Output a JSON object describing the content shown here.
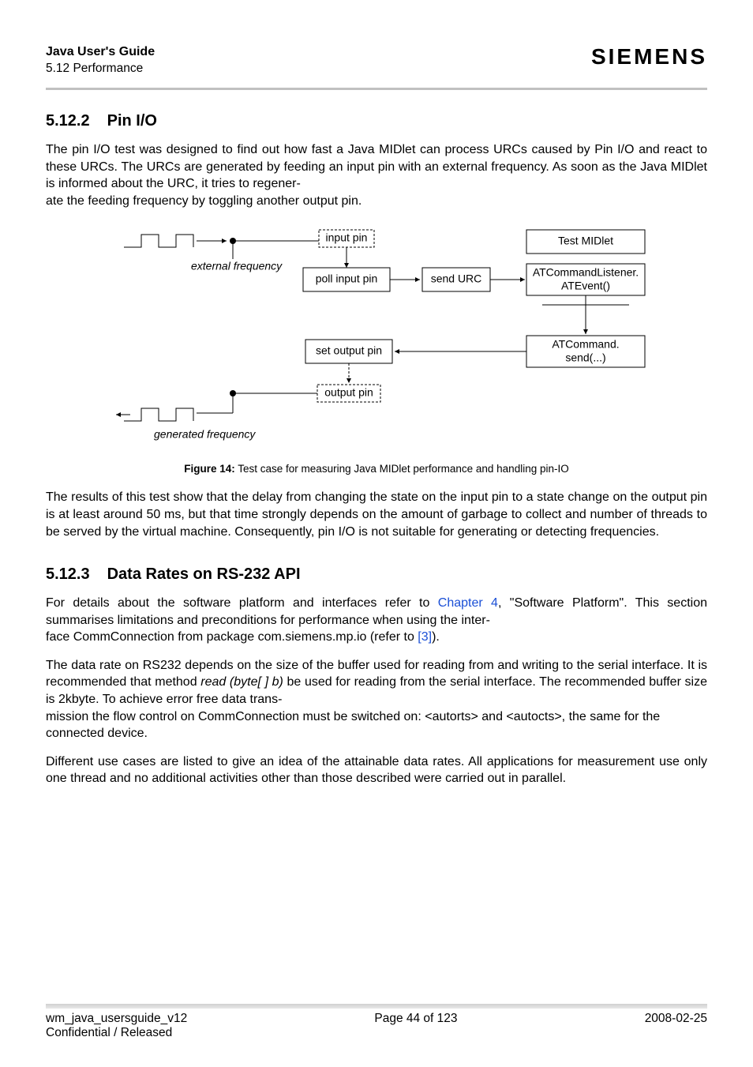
{
  "header": {
    "doc_title": "Java User's Guide",
    "doc_subtitle": "5.12 Performance",
    "brand": "SIEMENS"
  },
  "section1": {
    "number": "5.12.2",
    "title": "Pin I/O",
    "para1a": "The pin I/O test was designed to find out how fast a Java MIDlet can process URCs caused by Pin I/O and react to these URCs.  The URCs are generated by feeding an input pin with an external frequency. As soon as the Java MIDlet is informed about the URC, it tries to regener-",
    "para1b": "ate the feeding frequency by toggling another output pin."
  },
  "figure": {
    "labels": {
      "input_pin": "input pin",
      "external_frequency": "external frequency",
      "poll_input_pin": "poll input pin",
      "send_urc": "send URC",
      "test_midlet": "Test MIDlet",
      "at_listener_top": "ATCommandListener.",
      "at_listener_bot": "ATEvent()",
      "at_command_top": "ATCommand.",
      "at_command_bot": "send(...)",
      "set_output_pin": "set output pin",
      "output_pin": "output pin",
      "generated_frequency": "generated frequency"
    },
    "caption_bold": "Figure 14:",
    "caption_rest": "  Test case for measuring Java MIDlet performance and handling pin-IO"
  },
  "para2": "The results of this test show that the delay from changing the state on the input pin to a state change on the output pin is at least around 50 ms, but that time strongly depends on the amount of garbage to collect and number of threads to be served by the virtual machine. Consequently, pin I/O is not suitable for generating or detecting frequencies.",
  "section2": {
    "number": "5.12.3",
    "title": "Data Rates on RS-232 API",
    "para1_pre": "For details about the software platform and interfaces refer to ",
    "para1_link1": "Chapter 4",
    "para1_mid": ", \"Software Platform\". This section summarises limitations and preconditions for performance when using the inter-",
    "para1_row2": "face CommConnection from package com.siemens.mp.io (refer to ",
    "para1_link2": "[3]",
    "para1_post": ").",
    "para2_a": "The data rate on RS232 depends on the size of the buffer used for reading from and writing to the serial interface. It is recommended that method ",
    "para2_em": "read (byte[ ] b)",
    "para2_b": "  be used for reading from the serial interface. The recommended buffer size is 2kbyte. To achieve error free data trans-",
    "para2_c": "mission the flow control on CommConnection must be switched on: <autorts> and <autocts>, the same for the connected device.",
    "para3": "Different use cases are listed to give an idea of the attainable data rates. All applications for measurement use only one thread and no additional activities other than those described were carried out in parallel."
  },
  "footer": {
    "left1": "wm_java_usersguide_v12",
    "left2": "Confidential / Released",
    "center": "Page 44 of 123",
    "right": "2008-02-25"
  }
}
